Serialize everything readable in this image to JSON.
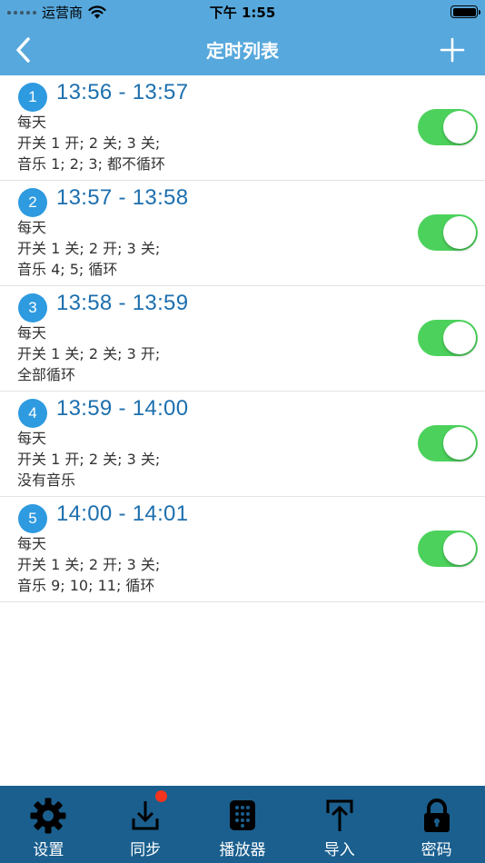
{
  "status": {
    "carrier": "运营商",
    "time": "下午 1:55"
  },
  "nav": {
    "title": "定时列表"
  },
  "timers": [
    {
      "index": "1",
      "time": "13:56 - 13:57",
      "repeat": "每天",
      "switches": "开关 1 开; 2 关; 3 关;",
      "music": "音乐 1; 2; 3; 都不循环",
      "enabled": true
    },
    {
      "index": "2",
      "time": "13:57 - 13:58",
      "repeat": "每天",
      "switches": "开关 1 关; 2 开; 3 关;",
      "music": "音乐 4; 5; 循环",
      "enabled": true
    },
    {
      "index": "3",
      "time": "13:58 - 13:59",
      "repeat": "每天",
      "switches": "开关 1 关; 2 关; 3 开;",
      "music": "全部循环",
      "enabled": true
    },
    {
      "index": "4",
      "time": "13:59 - 14:00",
      "repeat": "每天",
      "switches": "开关 1 开; 2 关; 3 关;",
      "music": "没有音乐",
      "enabled": true
    },
    {
      "index": "5",
      "time": "14:00 - 14:01",
      "repeat": "每天",
      "switches": "开关 1 关; 2 开; 3 关;",
      "music": "音乐 9; 10; 11; 循环",
      "enabled": true
    }
  ],
  "tabs": [
    {
      "label": "设置",
      "icon": "gear-icon"
    },
    {
      "label": "同步",
      "icon": "download-tray-icon",
      "has_badge": true
    },
    {
      "label": "播放器",
      "icon": "player-icon"
    },
    {
      "label": "导入",
      "icon": "upload-tray-icon"
    },
    {
      "label": "密码",
      "icon": "lock-icon"
    }
  ],
  "colors": {
    "nav_bg": "#57a8dc",
    "tab_bg": "#1a5f8e",
    "accent": "#2e9ae0",
    "switch_on": "#4cd25c",
    "badge_red": "#f2331d"
  }
}
